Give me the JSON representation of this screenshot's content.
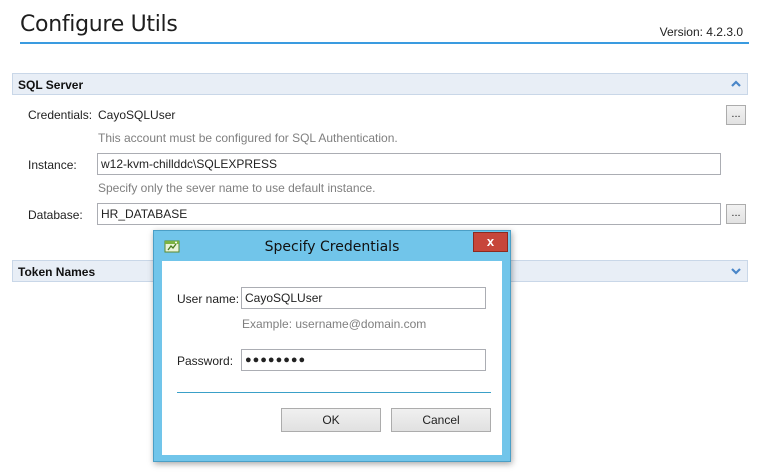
{
  "header": {
    "title": "Configure Utils",
    "version": "Version: 4.2.3.0"
  },
  "sql_section": {
    "title": "SQL Server",
    "collapse_icon": "chevron-up-icon",
    "credentials_label": "Credentials:",
    "credentials_value": "CayoSQLUser",
    "credentials_hint": "This account must be configured for SQL Authentication.",
    "instance_label": "Instance:",
    "instance_value": "w12-kvm-chillddc\\SQLEXPRESS",
    "instance_hint": "Specify only the sever name to use default instance.",
    "database_label": "Database:",
    "database_value": "HR_DATABASE",
    "browse_label": "..."
  },
  "token_section": {
    "title": "Token Names",
    "expand_icon": "chevron-down-icon"
  },
  "dialog": {
    "title": "Specify Credentials",
    "close_label": "x",
    "app_icon": "app-icon",
    "username_label": "User name:",
    "username_value": "CayoSQLUser",
    "username_hint": "Example:  username@domain.com",
    "password_label": "Password:",
    "password_value": "●●●●●●●●",
    "ok_label": "OK",
    "cancel_label": "Cancel"
  },
  "colors": {
    "title_underline": "#3a9be0",
    "section_header_bg": "#e8eef6",
    "chevron": "#4a86c8",
    "dialog_frame": "#71c5ea",
    "close_button": "#c7463a"
  }
}
